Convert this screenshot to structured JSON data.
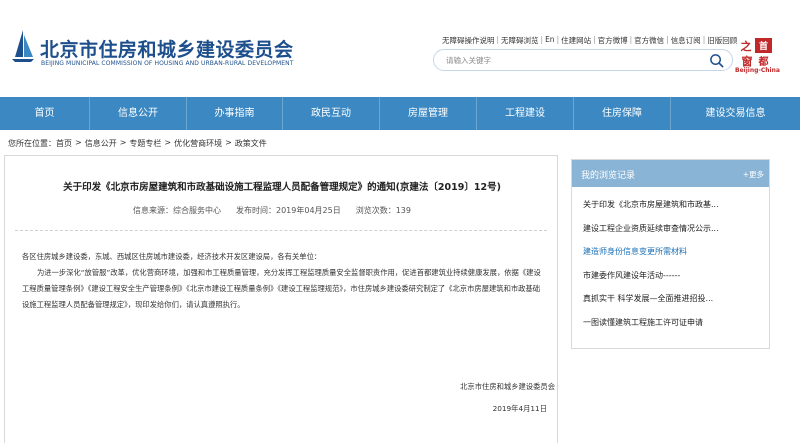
{
  "header": {
    "title": "北京市住房和城乡建设委员会",
    "subtitle": "BEIJING MUNICIPAL COMMISSION OF HOUSING AND URBAN-RURAL DEVELOPMENT",
    "top_links": [
      "无障碍操作说明",
      "无障碍浏览",
      "En",
      "住建网站",
      "官方微博",
      "官方微信",
      "信息订阅",
      "旧版回顾"
    ],
    "search_placeholder": "请输入关键字",
    "badge_chars": "首都之窗",
    "badge_caption": "Beijing-China",
    "brand_color": "#1d4f8c"
  },
  "nav": {
    "items": [
      "首页",
      "信息公开",
      "办事指南",
      "政民互动",
      "房屋管理",
      "工程建设",
      "住房保障",
      "建设交易信息"
    ],
    "background": "#3b88c3"
  },
  "breadcrumb": {
    "prefix": "您所在位置：",
    "items": [
      "首页",
      "信息公开",
      "专题专栏",
      "优化营商环境",
      "政策文件"
    ]
  },
  "article": {
    "title": "关于印发《北京市房屋建筑和市政基础设施工程监理人员配备管理规定》的通知(京建法〔2019〕12号)",
    "meta": {
      "source": "信息来源：综合服务中心",
      "date": "发布时间：2019年04月25日",
      "views": "浏览次数：139"
    },
    "greeting": "各区住房城乡建设委，东城、西城区住房城市建设委，经济技术开发区建设局，各有关单位：",
    "body": "为进一步深化“放管服”改革，优化营商环境，加强和市工程质量管理，充分发挥工程监理质量安全监督职责作用，促进首都建筑业持续健康发展，依据《建设工程质量管理条例》《建设工程安全生产管理条例》《北京市建设工程质量条例》《建设工程监理规范》，市住房城乡建设委研究制定了《北京市房屋建筑和市政基础设施工程监理人员配备管理规定》，现印发给你们，请认真遵照执行。",
    "signature_org": "北京市住房和城乡建设委员会",
    "signature_date": "2019年4月11日"
  },
  "sidebar": {
    "title": "我的浏览记录",
    "more": "+更多",
    "header_color": "#8ab4d6",
    "items": [
      "关于印发《北京市房屋建筑和市政基...",
      "建设工程企业资质延续审查情况公示...",
      "建造师身份信息变更所需材料",
      "市建委作风建设年活动------",
      "真抓实干 科学发展—全面推进招投...",
      "一图读懂建筑工程施工许可证申请"
    ]
  }
}
